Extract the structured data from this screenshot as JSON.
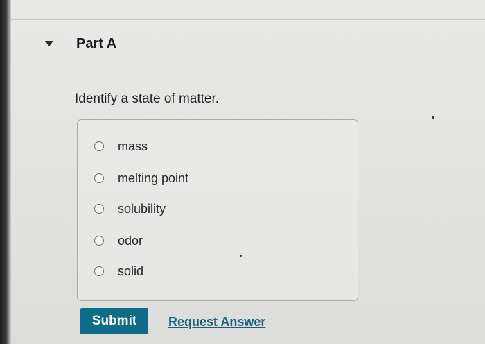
{
  "part": {
    "title": "Part A"
  },
  "question": {
    "text": "Identify a state of matter."
  },
  "options": [
    {
      "label": "mass",
      "selected": false
    },
    {
      "label": "melting point",
      "selected": false
    },
    {
      "label": "solubility",
      "selected": false
    },
    {
      "label": "odor",
      "selected": false
    },
    {
      "label": "solid",
      "selected": false
    }
  ],
  "actions": {
    "submit_label": "Submit",
    "request_answer_label": "Request Answer"
  },
  "colors": {
    "submit_bg": "#0f6c89",
    "link": "#1c5f7d"
  }
}
